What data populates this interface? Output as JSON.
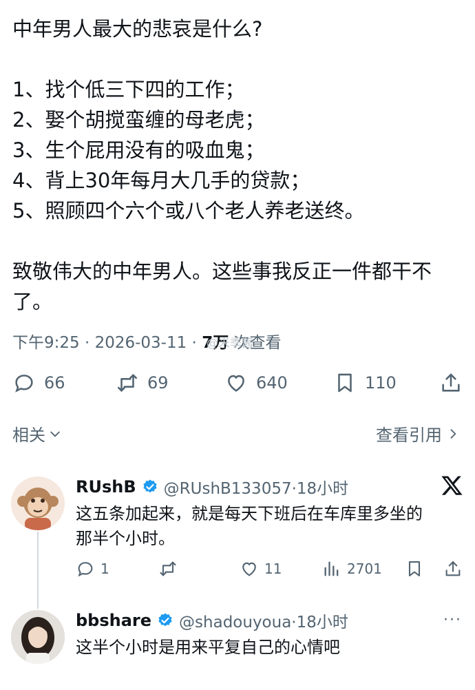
{
  "post": {
    "lines": [
      "中年男人最大的悲哀是什么?",
      "",
      "1、找个低三下四的工作；",
      "2、娶个胡搅蛮缠的母老虎；",
      "3、生个屁用没有的吸血鬼；",
      "4、背上30年每月大几手的贷款；",
      "5、照顾四个六个或八个老人养老送终。",
      "",
      "致敬伟大的中年男人。这些事我反正一件都干不",
      "了。"
    ],
    "time": "下午9:25 · 2026-03-11 · ",
    "views_count": "7万",
    "views_label": " 次查看",
    "watermark": "@米季酱"
  },
  "actions": {
    "replies": "66",
    "reposts": "69",
    "likes": "640",
    "bookmarks": "110"
  },
  "nav": {
    "related": "相关",
    "view_quotes": "查看引用"
  },
  "replies": [
    {
      "name": "RUshB",
      "handle": "@RUshB133057·18小时",
      "text_line1": "这五条加起来，就是每天下班后在车库里多坐的",
      "text_line2": "那半个小时。",
      "replies": "1",
      "reposts": "",
      "likes": "11",
      "views": "2701"
    },
    {
      "name": "bbshare",
      "handle": "@shadouyoua·18小时",
      "text_line1": "这半个小时是用来平复自己的心情吧"
    }
  ],
  "colors": {
    "text": "#0f1419",
    "secondary": "#536471",
    "verified": "#1d9bf0"
  },
  "icons": [
    "reply-icon",
    "repost-icon",
    "like-icon",
    "bookmark-icon",
    "share-icon",
    "chevron-down-icon",
    "chevron-right-icon",
    "verified-icon",
    "x-logo-icon",
    "views-icon",
    "more-icon"
  ]
}
